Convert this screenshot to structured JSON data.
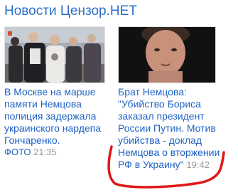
{
  "widget": {
    "title": "Новости Цензор.НЕТ"
  },
  "items": [
    {
      "headline": "В Москве на марше памяти Немцова полиция задержала украинского нардепа Гончаренко.",
      "tag": "ФОТО",
      "time": "21:35"
    },
    {
      "headline": "Брат Немцова: \"Убийство Бориса заказал президент России Путин. Мотив убийства - доклад Немцова о вторжении РФ в Украину\"",
      "time": "19:42"
    }
  ],
  "colors": {
    "link": "#1f63c4",
    "title": "#2a6fc9",
    "timestamp": "#9a9a9a",
    "annotation": "#e01818"
  }
}
